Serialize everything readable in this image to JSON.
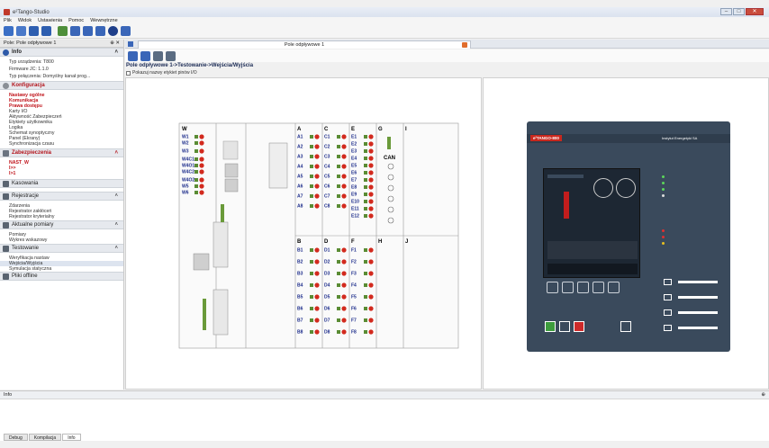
{
  "window": {
    "title": "e²Tango-Studio",
    "buttons": [
      "minimize",
      "maximize",
      "close"
    ]
  },
  "menu": [
    "Plik",
    "Widok",
    "Ustawienia",
    "Pomoc",
    "Wewnętrzne"
  ],
  "left_panel": {
    "header": "Pole: Pole odpływowe 1",
    "sections": [
      {
        "label": "Info",
        "items": [
          "Typ urządzenia: T800",
          "Firmware JC: 1.1.0",
          "Typ połączenia: Domyślny kanał prog..."
        ]
      },
      {
        "label": "Konfiguracja",
        "items": [
          "Nastawy ogólne",
          "Komunikacja",
          "Prawa dostępu",
          "Karty I/O",
          "Aktywność Zabezpieczeń",
          "Etykiety użytkownika",
          "Logika",
          "Schemat synoptyczny",
          "Panel (Ekrany)",
          "Synchronizacja czasu"
        ]
      },
      {
        "label": "Zabezpieczenia",
        "items": [
          "NAST_W",
          "I>>",
          "I>1"
        ]
      },
      {
        "label": "Kasowania",
        "items": []
      },
      {
        "label": "Rejestracje",
        "items": [
          "Zdarzenia",
          "Rejestrator zakłóceń",
          "Rejestrator kryterialny"
        ]
      },
      {
        "label": "Aktualne pomiary",
        "items": [
          "Pomiary",
          "Wykres wskazowy"
        ]
      },
      {
        "label": "Testowanie",
        "items": [
          "Weryfikacja nastaw",
          "Wejścia/Wyjścia",
          "Symulacja statyczna"
        ]
      },
      {
        "label": "Pliki offline",
        "items": []
      }
    ]
  },
  "doc_tab": {
    "label": "Pole odpływowe 1"
  },
  "breadcrumb": "Pole odpływowe 1->Testowanie->Wejścia/Wyjścia",
  "checkbox_label": "Pokazuj nazwy etykiet pinów I/O",
  "io_columns": {
    "W": [
      "W1",
      "W2",
      "W3",
      "W4C1",
      "W4O1",
      "W4C2",
      "W4O2",
      "W5",
      "W6"
    ],
    "A": [
      "A1",
      "A2",
      "A3",
      "A4",
      "A5",
      "A6",
      "A7",
      "A8"
    ],
    "C": [
      "C1",
      "C2",
      "C3",
      "C4",
      "C5",
      "C6",
      "C7",
      "C8"
    ],
    "E": [
      "E1",
      "E2",
      "E3",
      "E4",
      "E5",
      "E6",
      "E7",
      "E8",
      "E9",
      "E10",
      "E11",
      "E12"
    ],
    "B": [
      "B1",
      "B2",
      "B3",
      "B4",
      "B5",
      "B6",
      "B7",
      "B8"
    ],
    "D": [
      "D1",
      "D2",
      "D3",
      "D4",
      "D5",
      "D6",
      "D7",
      "D8"
    ],
    "F": [
      "F1",
      "F2",
      "F3",
      "F4",
      "F5",
      "F6",
      "F7",
      "F8"
    ]
  },
  "col_headers": [
    "W",
    "A",
    "C",
    "E",
    "G",
    "I",
    "B",
    "D",
    "F",
    "H",
    "J"
  ],
  "can_label": "CAN",
  "device": {
    "brand": "e²TANGO-800",
    "maker": "Instytut Energetyki SA"
  },
  "info_panel": {
    "label": "Info"
  },
  "bottom_tabs": [
    "Debug",
    "Kompilacja",
    "Info"
  ]
}
